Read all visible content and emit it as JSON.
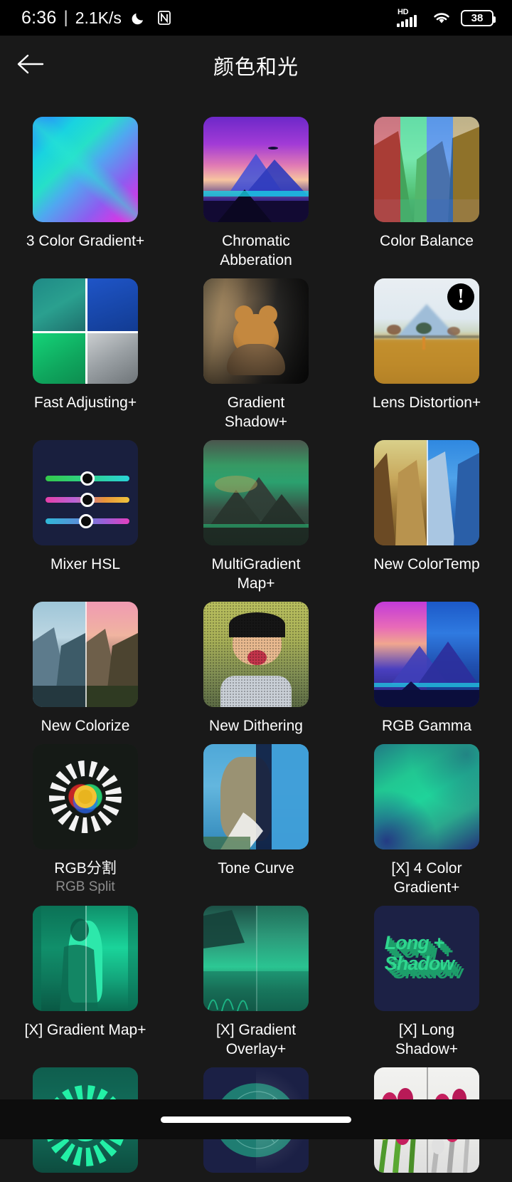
{
  "statusbar": {
    "time": "6:36",
    "separator": "|",
    "network_speed": "2.1K/s",
    "moon_icon": "moon-icon",
    "nfc_icon": "nfc-icon",
    "network_type": "HD",
    "signal_icon": "signal-bars-icon",
    "wifi_icon": "wifi-icon",
    "battery_level": "38"
  },
  "appbar": {
    "back_icon": "back-arrow-icon",
    "title": "颜色和光"
  },
  "colors": {
    "background": "#191919",
    "statusbar_bg": "#000000",
    "text_primary": "#ffffff",
    "text_secondary": "#8d8d8d",
    "navbar_bg": "#0d0d0d"
  },
  "effects": [
    {
      "id": "3-color-gradient-plus",
      "label": "3 Color Gradient+",
      "sublabel": "",
      "badge": ""
    },
    {
      "id": "chromatic-abberation",
      "label": "Chromatic Abberation",
      "sublabel": "",
      "badge": ""
    },
    {
      "id": "color-balance",
      "label": "Color Balance",
      "sublabel": "",
      "badge": ""
    },
    {
      "id": "fast-adjusting-plus",
      "label": "Fast Adjusting+",
      "sublabel": "",
      "badge": ""
    },
    {
      "id": "gradient-shadow-plus",
      "label": "Gradient Shadow+",
      "sublabel": "",
      "badge": ""
    },
    {
      "id": "lens-distortion-plus",
      "label": "Lens Distortion+",
      "sublabel": "",
      "badge": "!"
    },
    {
      "id": "mixer-hsl",
      "label": "Mixer HSL",
      "sublabel": "",
      "badge": ""
    },
    {
      "id": "multigradient-map-plus",
      "label": "MultiGradient Map+",
      "sublabel": "",
      "badge": ""
    },
    {
      "id": "new-colortemp",
      "label": "New ColorTemp",
      "sublabel": "",
      "badge": ""
    },
    {
      "id": "new-colorize",
      "label": "New Colorize",
      "sublabel": "",
      "badge": ""
    },
    {
      "id": "new-dithering",
      "label": "New Dithering",
      "sublabel": "",
      "badge": ""
    },
    {
      "id": "rgb-gamma",
      "label": "RGB Gamma",
      "sublabel": "",
      "badge": ""
    },
    {
      "id": "rgb-split",
      "label": "RGB分割",
      "sublabel": "RGB Split",
      "badge": ""
    },
    {
      "id": "tone-curve",
      "label": "Tone Curve",
      "sublabel": "",
      "badge": ""
    },
    {
      "id": "x-4-color-gradient-plus",
      "label": "[X] 4 Color Gradient+",
      "sublabel": "",
      "badge": ""
    },
    {
      "id": "x-gradient-map-plus",
      "label": "[X] Gradient Map+",
      "sublabel": "",
      "badge": ""
    },
    {
      "id": "x-gradient-overlay-plus",
      "label": "[X] Gradient Overlay+",
      "sublabel": "",
      "badge": ""
    },
    {
      "id": "x-long-shadow-plus",
      "label": "[X] Long Shadow+",
      "sublabel": "",
      "badge": ""
    },
    {
      "id": "green-flower-effect",
      "label": "",
      "sublabel": "",
      "badge": ""
    },
    {
      "id": "teal-circle-effect",
      "label": "",
      "sublabel": "",
      "badge": ""
    },
    {
      "id": "tulips-effect",
      "label": "",
      "sublabel": "",
      "badge": ""
    }
  ],
  "long_shadow_tile": {
    "line1": "Long +",
    "line2": "Shadow"
  },
  "navbar": {
    "gesture_pill": "home-gesture-pill"
  }
}
